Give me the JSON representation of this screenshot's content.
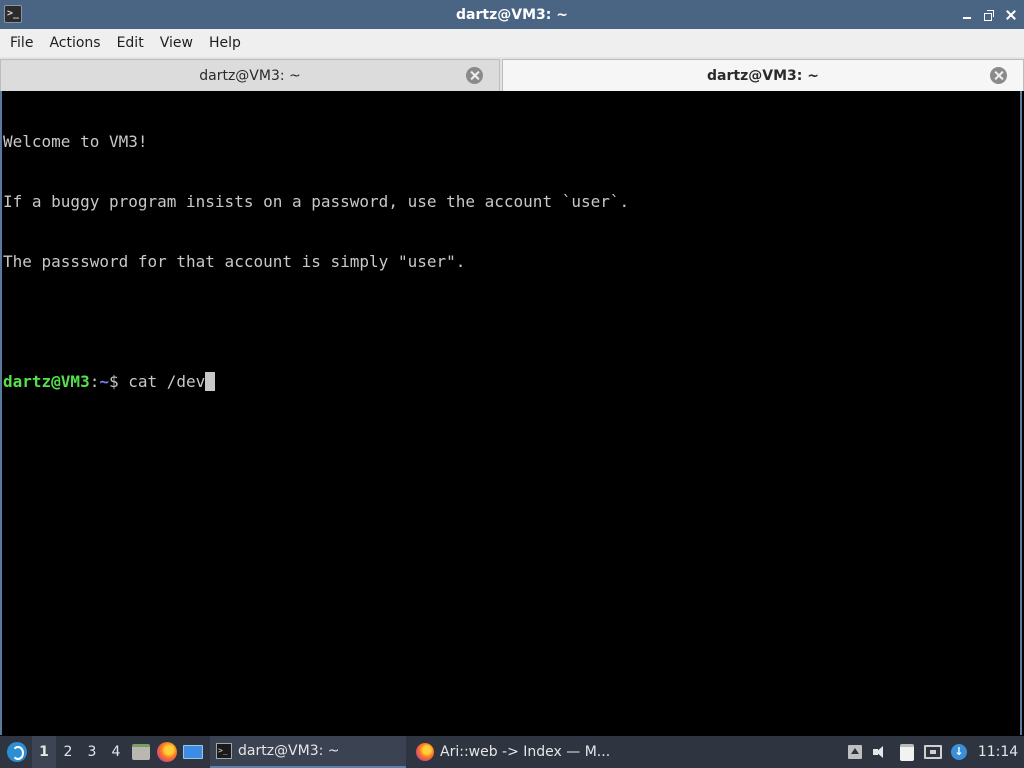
{
  "window": {
    "title": "dartz@VM3: ~",
    "app_icon": "terminal-icon"
  },
  "menu": [
    "File",
    "Actions",
    "Edit",
    "View",
    "Help"
  ],
  "tabs": [
    {
      "label": "dartz@VM3: ~",
      "active": false
    },
    {
      "label": "dartz@VM3: ~",
      "active": true
    }
  ],
  "terminal": {
    "lines": [
      "Welcome to VM3!",
      "If a buggy program insists on a password, use the account `user`.",
      "The passsword for that account is simply \"user\".",
      ""
    ],
    "prompt_user": "dartz@VM3",
    "prompt_sep": ":",
    "prompt_path": "~",
    "prompt_symbol": "$ ",
    "command": "cat /dev"
  },
  "taskbar": {
    "workspaces": [
      "1",
      "2",
      "3",
      "4"
    ],
    "current_workspace": "1",
    "launchers": [
      "file-manager-icon",
      "firefox-icon",
      "show-desktop-icon"
    ],
    "tasks": [
      {
        "label": "dartz@VM3: ~",
        "icon": "terminal-icon",
        "active": true
      },
      {
        "label": "Ari::web -> Index — M...",
        "icon": "firefox-icon",
        "active": false
      }
    ],
    "tray": [
      "tray-expand-icon",
      "volume-icon",
      "clipboard-icon",
      "network-icon",
      "update-icon"
    ],
    "clock": "11:14"
  },
  "colors": {
    "titlebar": "#4a6484",
    "prompt_user": "#54e04a",
    "prompt_path": "#7b7bf2",
    "terminal_bg": "#000000",
    "terminal_fg": "#c8c8c8",
    "taskbar_bg": "#2e3440"
  }
}
